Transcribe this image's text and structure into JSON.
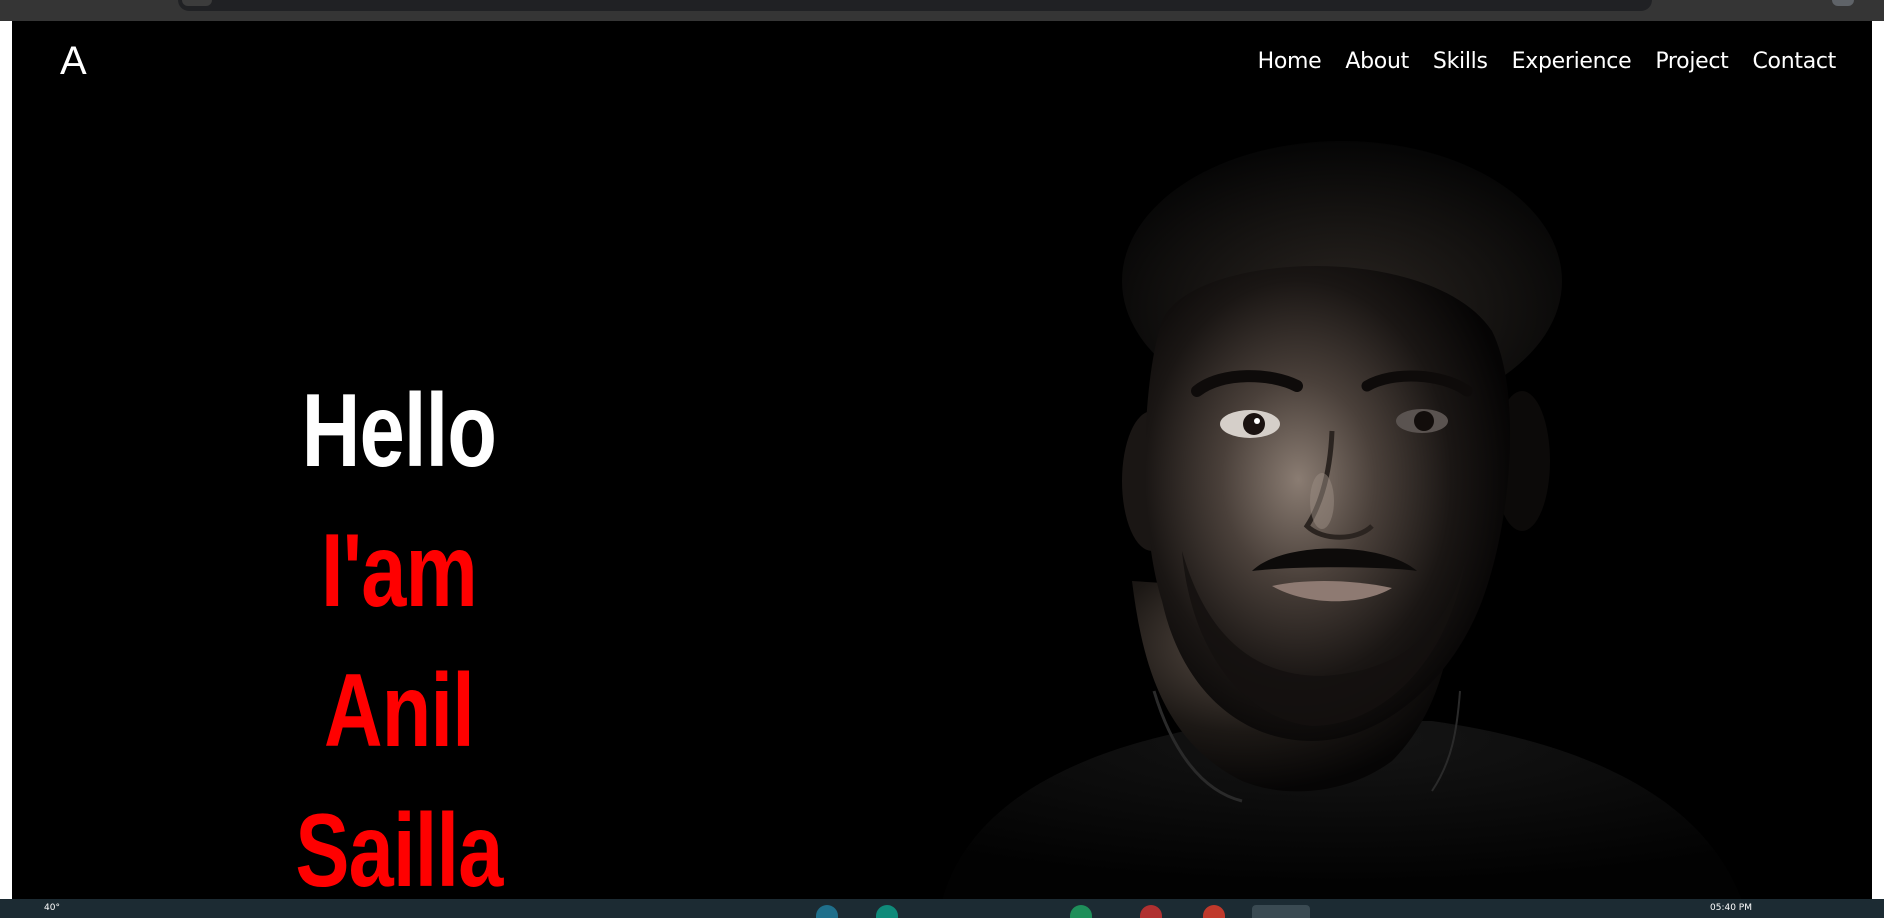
{
  "site": {
    "logo": "A",
    "nav": [
      {
        "label": "Home"
      },
      {
        "label": "About"
      },
      {
        "label": "Skills"
      },
      {
        "label": "Experience"
      },
      {
        "label": "Project"
      },
      {
        "label": "Contact"
      }
    ]
  },
  "hero": {
    "greeting": "Hello",
    "intro": "I'am",
    "name": "Anil Sailla",
    "greeting_color": "#ffffff",
    "name_color": "#ff0000",
    "portrait_icon": "profile-photo"
  },
  "taskbar": {
    "weather": "40°",
    "time": "05:40 PM"
  },
  "colors": {
    "background": "#000000",
    "text": "#ffffff",
    "accent": "#ff0000"
  }
}
